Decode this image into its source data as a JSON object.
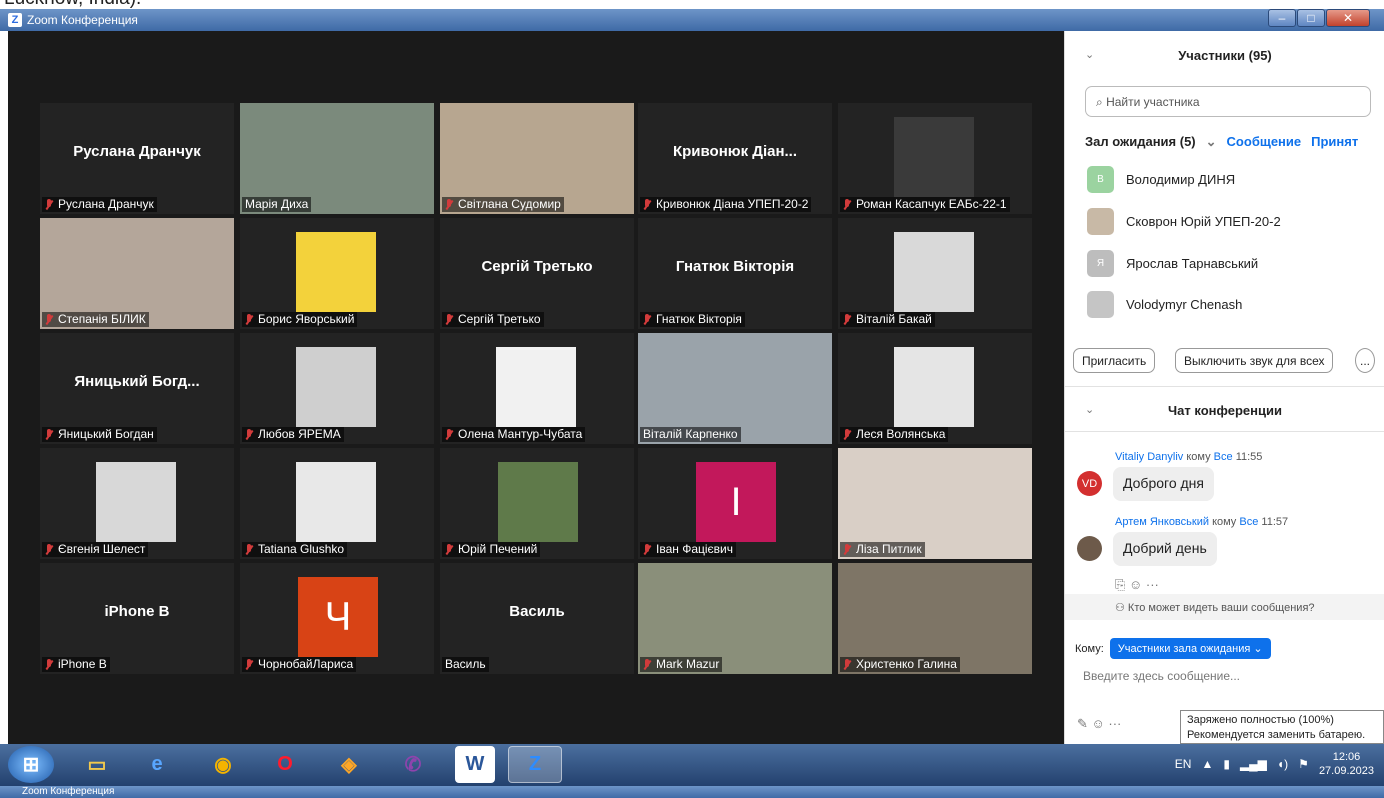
{
  "window": {
    "title": "Zoom Конференция",
    "top_cut_text": "Lucknow, India)."
  },
  "tiles": [
    {
      "name": "Руслана Дранчук",
      "label": "Руслана Дранчук",
      "muted": true,
      "style": "name"
    },
    {
      "name": "",
      "label": "Марія Диха",
      "muted": false,
      "style": "video",
      "bg": "#7b8a7c"
    },
    {
      "name": "",
      "label": "Світлана Судомир",
      "muted": true,
      "style": "video",
      "bg": "#b7a690"
    },
    {
      "name": "Кривонюк Діан...",
      "label": "Кривонюк Діана УПЕП-20-2",
      "muted": true,
      "style": "name"
    },
    {
      "name": "",
      "label": "Роман Касапчук ЕАБс-22-1",
      "muted": true,
      "style": "photo",
      "bg": "#3a3a3a"
    },
    {
      "name": "",
      "label": "Степанія БІЛИК",
      "muted": true,
      "style": "video",
      "bg": "#b4a69a"
    },
    {
      "name": "",
      "label": "Борис Яворський",
      "muted": true,
      "style": "photo",
      "bg": "#f3d23b"
    },
    {
      "name": "Сергій Третько",
      "label": "Сергій Третько",
      "muted": true,
      "style": "name"
    },
    {
      "name": "Гнатюк Вікторія",
      "label": "Гнатюк Вікторія",
      "muted": true,
      "style": "name"
    },
    {
      "name": "",
      "label": "Віталій Бакай",
      "muted": true,
      "style": "photo",
      "bg": "#d9d9d9"
    },
    {
      "name": "Яницький Богд...",
      "label": "Яницький Богдан",
      "muted": true,
      "style": "name"
    },
    {
      "name": "",
      "label": "Любов ЯРЕМА",
      "muted": true,
      "style": "photo",
      "bg": "#cfcfcf"
    },
    {
      "name": "",
      "label": "Олена Мантур-Чубата",
      "muted": true,
      "style": "photo",
      "bg": "#f1f1f1"
    },
    {
      "name": "",
      "label": "Віталій Карпенко",
      "muted": false,
      "style": "video",
      "bg": "#9aa3aa",
      "active": true
    },
    {
      "name": "",
      "label": "Леся Волянська",
      "muted": true,
      "style": "photo",
      "bg": "#e5e5e5"
    },
    {
      "name": "",
      "label": "Євгенія Шелест",
      "muted": true,
      "style": "photo",
      "bg": "#d8d8d8"
    },
    {
      "name": "",
      "label": "Tatiana Glushko",
      "muted": true,
      "style": "photo",
      "bg": "#e8e8e8"
    },
    {
      "name": "",
      "label": "Юрій Печений",
      "muted": true,
      "style": "square",
      "bg": "#5f7a4a",
      "letter": ""
    },
    {
      "name": "",
      "label": "Іван Фацієвич",
      "muted": true,
      "style": "square",
      "bg": "#c2185b",
      "letter": "I"
    },
    {
      "name": "",
      "label": "Ліза Питлик",
      "muted": true,
      "style": "video",
      "bg": "#d9cfc6"
    },
    {
      "name": "iPhone B",
      "label": "iPhone B",
      "muted": true,
      "style": "name"
    },
    {
      "name": "",
      "label": "ЧорнобайЛариса",
      "muted": true,
      "style": "square",
      "bg": "#d84315",
      "letter": "Ч"
    },
    {
      "name": "Василь",
      "label": "Василь",
      "muted": false,
      "style": "name"
    },
    {
      "name": "",
      "label": "Mark Mazur",
      "muted": true,
      "style": "video",
      "bg": "#8a8f7a"
    },
    {
      "name": "",
      "label": "Христенко Галина",
      "muted": true,
      "style": "video",
      "bg": "#7e7566"
    }
  ],
  "participants": {
    "title": "Участники (95)",
    "search_placeholder": "Найти участника",
    "waiting_label": "Зал ожидания (5)",
    "message_label": "Сообщение",
    "accept_label": "Принят",
    "people": [
      {
        "name": "Володимир ДИНЯ",
        "initial": "В",
        "color": "#9bd3a0"
      },
      {
        "name": "Сковрон Юрій УПЕП-20-2",
        "initial": "",
        "color": "#c8b9a6"
      },
      {
        "name": "Ярослав Тарнавський",
        "initial": "Я",
        "color": "#bdbdbd"
      },
      {
        "name": "Volodymyr Chenash",
        "initial": "",
        "color": "#c5c5c5"
      }
    ],
    "invite_label": "Пригласить",
    "mute_all_label": "Выключить звук для всех",
    "more_label": "..."
  },
  "chat": {
    "title": "Чат конференции",
    "messages": [
      {
        "sender": "Vitaliy Danyliv",
        "to_word": "кому",
        "to": "Все",
        "time": "11:55",
        "text": "Доброго дня",
        "initials": "VD",
        "color": "#d32f2f"
      },
      {
        "sender": "Артем Янковський",
        "to_word": "кому",
        "to": "Все",
        "time": "11:57",
        "text": "Добрий день",
        "initials": "",
        "color": "#6d5a4a"
      }
    ],
    "privacy": "Кто может видеть ваши сообщения?",
    "to_label": "Кому:",
    "to_value": "Участники зала ожидания",
    "input_placeholder": "Введите здесь сообщение..."
  },
  "tooltip": {
    "line1": "Заряжено полностью (100%)",
    "line2": "Рекомендуется заменить батарею."
  },
  "taskbar": {
    "lang": "EN",
    "time": "12:06",
    "date": "27.09.2023"
  }
}
